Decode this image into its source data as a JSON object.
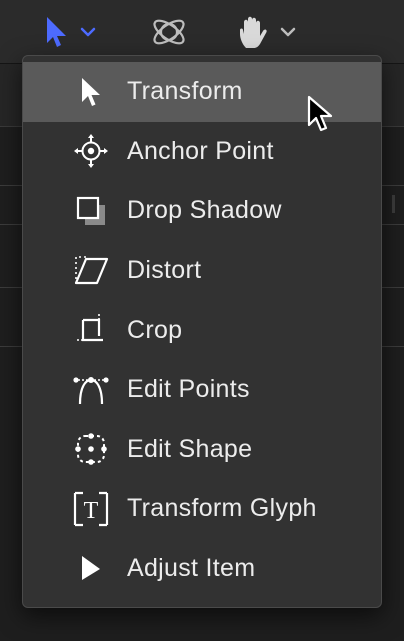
{
  "toolbar": {
    "tools": [
      {
        "icon": "select-arrow-icon",
        "active": true,
        "has_menu": true
      },
      {
        "icon": "3d-orbit-icon",
        "active": false,
        "has_menu": false
      },
      {
        "icon": "pan-hand-icon",
        "active": false,
        "has_menu": true
      }
    ],
    "accent_color": "#4d6bff"
  },
  "menu": {
    "selected_index": 0,
    "items": [
      {
        "label": "Transform",
        "icon": "arrow-pointer-icon"
      },
      {
        "label": "Anchor Point",
        "icon": "anchor-point-icon"
      },
      {
        "label": "Drop Shadow",
        "icon": "drop-shadow-icon"
      },
      {
        "label": "Distort",
        "icon": "distort-icon"
      },
      {
        "label": "Crop",
        "icon": "crop-icon"
      },
      {
        "label": "Edit Points",
        "icon": "edit-points-icon"
      },
      {
        "label": "Edit Shape",
        "icon": "edit-shape-icon"
      },
      {
        "label": "Transform Glyph",
        "icon": "transform-glyph-icon"
      },
      {
        "label": "Adjust Item",
        "icon": "adjust-item-icon"
      }
    ]
  }
}
